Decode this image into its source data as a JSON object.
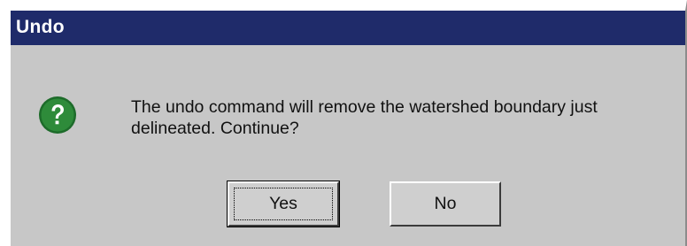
{
  "window": {
    "title": "Undo"
  },
  "message": {
    "icon": "question-icon",
    "text": "The undo command will remove the watershed boundary just delineated. Continue?"
  },
  "buttons": {
    "yes_label": "Yes",
    "no_label": "No",
    "default": "Yes"
  },
  "colors": {
    "titlebar": "#1f2b6a",
    "dialog_bg": "#c7c7c7",
    "icon_green": "#2e8b3a"
  }
}
